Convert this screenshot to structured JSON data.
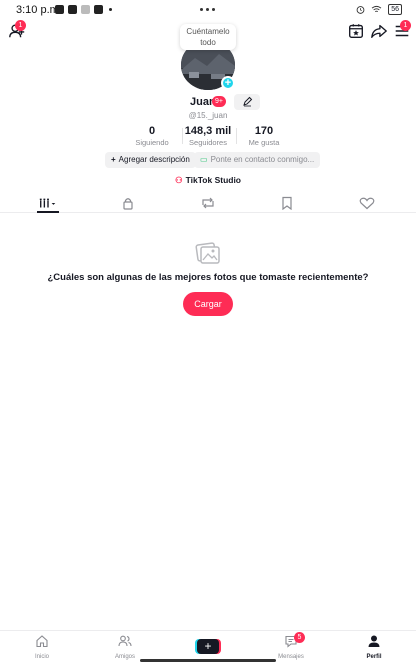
{
  "status_bar": {
    "time": "3:10 p.m.",
    "battery": "56"
  },
  "top_bar": {
    "add_friend_badge": "1",
    "menu_badge": "1"
  },
  "profile": {
    "bubble_text": "Cuéntamelo todo",
    "name": "Juan",
    "name_badge": "9+",
    "handle": "@15._juan"
  },
  "stats": [
    {
      "value": "0",
      "label": "Siguiendo"
    },
    {
      "value": "148,3 mil",
      "label": "Seguidores"
    },
    {
      "value": "170",
      "label": "Me gusta"
    }
  ],
  "actions": {
    "add_description": "Agregar descripción",
    "contact_note": "Ponte en contacto conmigo..."
  },
  "studio_label": "TikTok Studio",
  "tabs": [
    "videos-grid-icon",
    "lock-icon",
    "repost-icon",
    "bookmark-icon",
    "heart-icon"
  ],
  "empty_state": {
    "title": "¿Cuáles son algunas de las mejores fotos que tomaste recientemente?",
    "button": "Cargar"
  },
  "bottom_nav": {
    "home": "Inicio",
    "friends": "Amigos",
    "messages": "Mensajes",
    "messages_badge": "5",
    "profile": "Perfil"
  },
  "colors": {
    "accent": "#fe2c55",
    "cyan": "#20d5ec",
    "text": "#161823",
    "muted": "#8a8b91"
  }
}
